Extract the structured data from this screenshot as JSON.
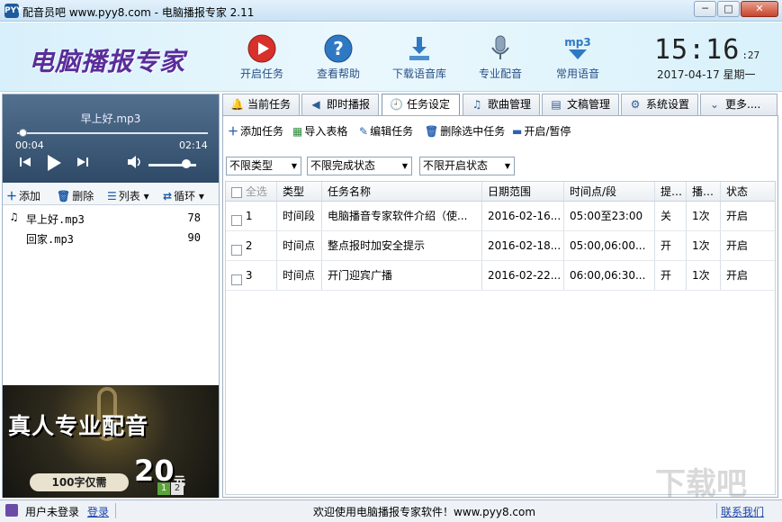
{
  "window": {
    "title": "配音员吧 www.pyy8.com - 电脑播报专家 2.11",
    "app_icon": "PYY",
    "min": "─",
    "max": "□",
    "close": "✕"
  },
  "header": {
    "logo": "电脑播报专家",
    "tools": [
      {
        "label": "开启任务",
        "icon": "play-red-icon"
      },
      {
        "label": "查看帮助",
        "icon": "help-icon"
      },
      {
        "label": "下载语音库",
        "icon": "download-icon"
      },
      {
        "label": "专业配音",
        "icon": "microphone-icon"
      },
      {
        "label": "常用语音",
        "icon": "mp3-icon"
      }
    ],
    "clock": {
      "hm": "15:16",
      "sec": ":27",
      "date": "2017-04-17 星期一"
    }
  },
  "player": {
    "song": "早上好.mp3",
    "elapsed": "00:04",
    "duration": "02:14",
    "progress": 0.03,
    "volume": 0.8
  },
  "playlist_toolbar": {
    "add": "添加",
    "delete": "删除",
    "list": "列表",
    "loop": "循环"
  },
  "playlist": [
    {
      "name": "早上好.mp3",
      "count": "78",
      "playing": true
    },
    {
      "name": "回家.mp3",
      "count": "90",
      "playing": false
    }
  ],
  "ad": {
    "headline": "真人专业配音",
    "price_text": "100字仅需",
    "price": "20",
    "unit": "元",
    "d1": "1",
    "d2": "2"
  },
  "tabs": [
    {
      "label": "当前任务",
      "icon": "bell-icon",
      "active": false
    },
    {
      "label": "即时播报",
      "icon": "speaker-icon",
      "active": false
    },
    {
      "label": "任务设定",
      "icon": "clock-icon",
      "active": true
    },
    {
      "label": "歌曲管理",
      "icon": "music-icon",
      "active": false
    },
    {
      "label": "文稿管理",
      "icon": "document-icon",
      "active": false
    },
    {
      "label": "系统设置",
      "icon": "gear-icon",
      "active": false
    },
    {
      "label": "更多....",
      "icon": "chevron-down-icon",
      "active": false
    }
  ],
  "task_toolbar": {
    "add": "添加任务",
    "import": "导入表格",
    "edit": "编辑任务",
    "delete": "删除选中任务",
    "toggle": "开启/暂停"
  },
  "filters": {
    "type": "不限类型",
    "complete": "不限完成状态",
    "enable": "不限开启状态"
  },
  "table": {
    "columns": [
      "全选",
      "类型",
      "任务名称",
      "日期范围",
      "时间点/段",
      "提…",
      "播…",
      "状态"
    ],
    "rows": [
      {
        "no": "1",
        "type": "时间段",
        "name": "电脑播音专家软件介绍（使...",
        "date": "2016-02-16...",
        "time": "05:00至23:00",
        "remind": "关",
        "play": "1次",
        "status": "开启"
      },
      {
        "no": "2",
        "type": "时间点",
        "name": "整点报时加安全提示",
        "date": "2016-02-18...",
        "time": "05:00,06:00...",
        "remind": "开",
        "play": "1次",
        "status": "开启"
      },
      {
        "no": "3",
        "type": "时间点",
        "name": "开门迎宾广播",
        "date": "2016-02-22...",
        "time": "06:00,06:30...",
        "remind": "开",
        "play": "1次",
        "status": "开启"
      }
    ]
  },
  "statusbar": {
    "user": "用户未登录",
    "login": "登录",
    "welcome": "欢迎使用电脑播报专家软件！www.pyy8.com",
    "contact": "联系我们"
  },
  "watermark": "下载吧"
}
